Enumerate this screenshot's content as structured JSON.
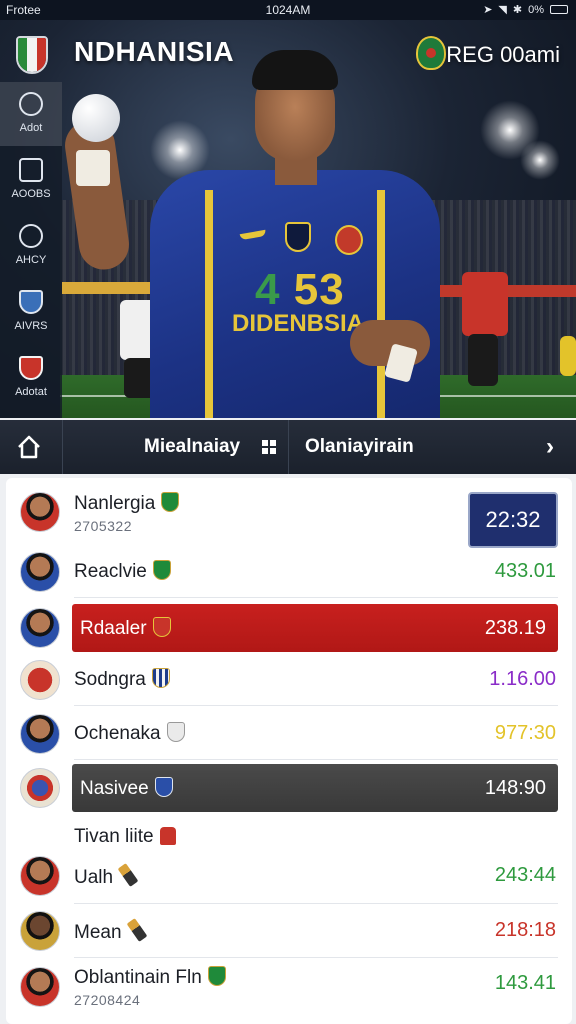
{
  "status_bar": {
    "carrier": "Frotee",
    "time": "1024AM",
    "battery": "0%"
  },
  "header": {
    "title": "NDHANISIA",
    "right_text": "REG 00ami"
  },
  "hero": {
    "jersey_number": "53",
    "jersey_prefix": "4",
    "jersey_text": "DIDENBSIA",
    "colors": {
      "jersey": "#1c3284",
      "trim": "#e6c53a"
    }
  },
  "rail": {
    "items": [
      {
        "label": "Adot",
        "icon": "clock-icon"
      },
      {
        "label": "AOOBS",
        "icon": "document-icon"
      },
      {
        "label": "AHCY",
        "icon": "search-icon"
      },
      {
        "label": "AIVRS",
        "icon": "shield-icon"
      },
      {
        "label": "Adotat",
        "icon": "red-shield-icon"
      }
    ]
  },
  "nav": {
    "tab1": "Miealnaiay",
    "tab2": "Olaniayirain"
  },
  "list": {
    "rows": [
      {
        "name": "Nanlergia",
        "sub": "2705322",
        "value": "22:32",
        "value_color": "#ffffff",
        "style": "time-box"
      },
      {
        "name": "Reaclvie",
        "value": "433.01",
        "value_color": "#2e9a3e"
      },
      {
        "name": "Rdaaler",
        "value": "238.19",
        "value_color": "#ffffff",
        "style": "red"
      },
      {
        "name": "Sodngra",
        "value": "1.16.00",
        "value_color": "#8a2cc8"
      },
      {
        "name": "Ochenaka",
        "value": "977:30",
        "value_color": "#e3c32a"
      },
      {
        "name": "Nasivee",
        "value": "148:90",
        "value_color": "#ffffff",
        "style": "dark"
      }
    ],
    "section_label": "Tivan liite",
    "rows2": [
      {
        "name": "Ualh",
        "value": "243:44",
        "value_color": "#2e9a3e"
      },
      {
        "name": "Mean",
        "value": "218:18",
        "value_color": "#c8342a"
      },
      {
        "name": "Oblantinain Fln",
        "sub": "27208424",
        "value": "143.41",
        "value_color": "#2e9a3e"
      }
    ]
  }
}
